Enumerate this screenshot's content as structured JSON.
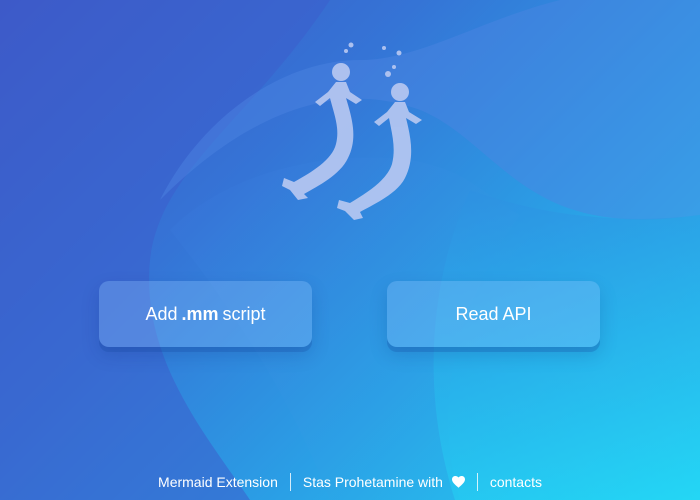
{
  "colors": {
    "bg_top_left": "#3f55c4",
    "bg_bottom_right": "#23dcf6",
    "button_fill": "rgba(150,200,255,0.30)",
    "text": "#ffffff"
  },
  "logo": {
    "icon": "two-mermaids-logo-icon"
  },
  "buttons": {
    "add_script": {
      "prefix": "Add",
      "bold": ".mm",
      "suffix": "script"
    },
    "read_api": {
      "label": "Read API"
    }
  },
  "footer": {
    "extension_name": "Mermaid Extension",
    "author_text": "Stas Prohetamine with",
    "heart_icon": "heart-icon",
    "contacts_label": "contacts"
  }
}
